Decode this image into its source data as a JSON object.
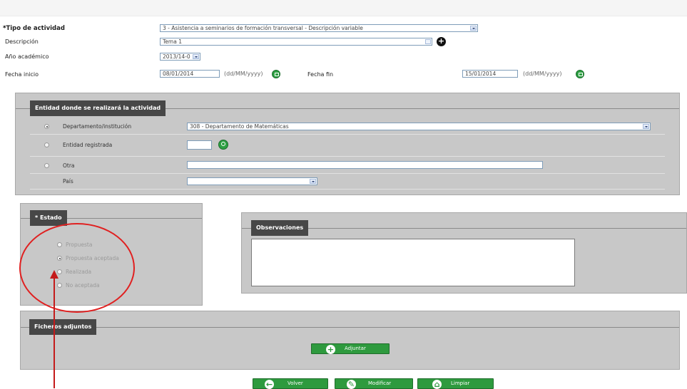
{
  "form": {
    "tipo_label": "Tipo de actividad",
    "tipo_required": "*",
    "tipo_value": "3 - Asistencia a seminarios de formación transversal - Descripción variable",
    "descripcion_label": "Descripción",
    "descripcion_value": "Tema 1",
    "anio_label": "Año académico",
    "anio_value": "2013/14-0",
    "fecha_inicio_label": "Fecha inicio",
    "fecha_inicio_value": "08/01/2014",
    "fecha_fin_label": "Fecha fin",
    "fecha_fin_value": "15/01/2014",
    "date_hint": "(dd/MM/yyyy)"
  },
  "entidad": {
    "legend": "Entidad donde se realizará la actividad",
    "options": [
      {
        "label": "Departamento/institución",
        "checked": true
      },
      {
        "label": "Entidad registrada",
        "checked": false
      },
      {
        "label": "Otra",
        "checked": false
      }
    ],
    "departamento_value": "308 - Departamento de Matemáticas",
    "entidad_value": "",
    "otra_value": "",
    "pais_label": "País",
    "pais_value": ""
  },
  "estado": {
    "legend": "* Estado",
    "options": [
      {
        "label": "Propuesta",
        "checked": false
      },
      {
        "label": "Propuesta aceptada",
        "checked": true
      },
      {
        "label": "Realizada",
        "checked": false
      },
      {
        "label": "No aceptada",
        "checked": false
      }
    ]
  },
  "observaciones": {
    "legend": "Observaciones",
    "value": ""
  },
  "ficheros": {
    "legend": "Ficheros adjuntos",
    "adjuntar_label": "Adjuntar"
  },
  "actions": {
    "volver_label": "Volver",
    "modificar_label": "Modificar",
    "limpiar_label": "Limpiar"
  },
  "colors": {
    "legend_bg": "#474747",
    "panel_bg": "#c8c8c8",
    "button_green": "#2e9a3e",
    "annotation_red": "#e02020"
  },
  "icons": [
    "calendar-icon",
    "search-icon",
    "add-icon",
    "plus-icon",
    "back-icon",
    "edit-icon",
    "clear-icon",
    "annotation-arrow"
  ]
}
